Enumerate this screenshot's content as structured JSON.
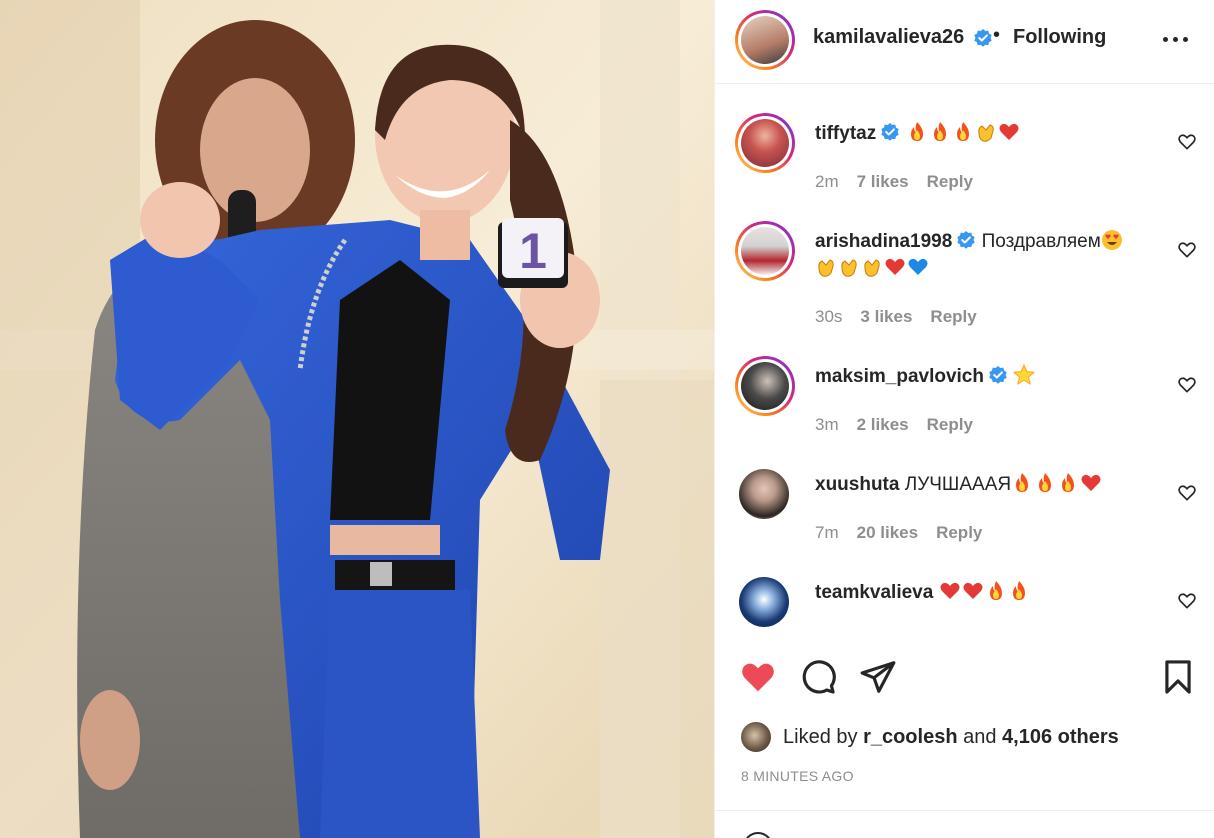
{
  "post": {
    "author": "kamilavalieva26",
    "follow_separator": "•",
    "follow_state": "Following"
  },
  "comments": [
    {
      "username": "tiffytaz",
      "verified": true,
      "text": "",
      "emojis": [
        "fire",
        "fire",
        "fire",
        "clap",
        "red-heart"
      ],
      "time": "2m",
      "likes": "7 likes",
      "reply": "Reply"
    },
    {
      "username": "arishadina1998",
      "verified": true,
      "text": "Поздравляем",
      "emojis": [
        "heart-eyes",
        "clap",
        "clap",
        "clap",
        "red-heart",
        "blue-heart"
      ],
      "time": "30s",
      "likes": "3 likes",
      "reply": "Reply"
    },
    {
      "username": "maksim_pavlovich",
      "verified": true,
      "text": "",
      "emojis": [
        "star"
      ],
      "time": "3m",
      "likes": "2 likes",
      "reply": "Reply"
    },
    {
      "username": "xuushuta",
      "verified": false,
      "text": "ЛУЧШАААЯ",
      "emojis": [
        "fire",
        "fire",
        "fire",
        "red-heart"
      ],
      "time": "7m",
      "likes": "20 likes",
      "reply": "Reply"
    },
    {
      "username": "teamkvalieva",
      "verified": false,
      "text": "",
      "emojis": [
        "red-heart",
        "red-heart",
        "fire",
        "fire"
      ],
      "time": "",
      "likes": "",
      "reply": ""
    }
  ],
  "likes_summary": {
    "prefix": "Liked by",
    "user": "r_coolesh",
    "joiner": "and",
    "others": "4,106 others"
  },
  "timestamp": "8 MINUTES AGO",
  "photo_card_number": "1",
  "colors": {
    "like_active": "#ed4956",
    "verified": "#3897f0",
    "muted": "#8e8e8e",
    "suit_blue": "#2a57c9"
  },
  "icons": {
    "like": "heart-filled-icon",
    "comment": "comment-bubble-icon",
    "share": "paper-plane-icon",
    "save": "bookmark-icon",
    "more": "more-dots-icon",
    "verified": "verified-badge-icon",
    "comment_like": "heart-outline-icon"
  }
}
